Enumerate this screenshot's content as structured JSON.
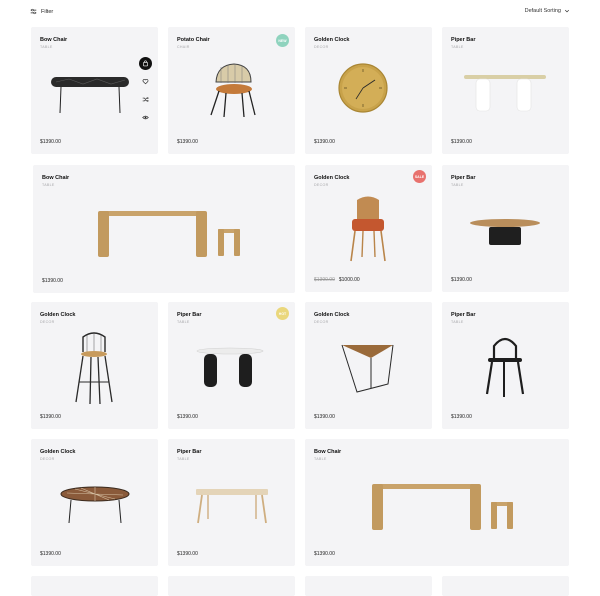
{
  "toolbar": {
    "filter_label": "Filter",
    "sort_label": "Default Sorting"
  },
  "products": [
    {
      "title": "Bow Chair",
      "category": "TABLE",
      "price": "$1390.00"
    },
    {
      "title": "Potato Chair",
      "category": "CHAIR",
      "price": "$1390.00",
      "badge": "NEW",
      "badge_color": "#8fd3be"
    },
    {
      "title": "Golden Clock",
      "category": "DECOR",
      "price": "$1390.00"
    },
    {
      "title": "Piper Bar",
      "category": "TABLE",
      "price": "$1390.00"
    },
    {
      "title": "Bow Chair",
      "category": "TABLE",
      "price": "$1390.00"
    },
    {
      "title": "Golden Clock",
      "category": "DECOR",
      "price": "$1000.00",
      "old_price": "$1390.00",
      "badge": "SALE",
      "badge_color": "#e8726e"
    },
    {
      "title": "Piper Bar",
      "category": "TABLE",
      "price": "$1390.00"
    },
    {
      "title": "Golden Clock",
      "category": "DECOR",
      "price": "$1390.00"
    },
    {
      "title": "Piper Bar",
      "category": "TABLE",
      "price": "$1390.00",
      "badge": "HOT",
      "badge_color": "#ead77c"
    },
    {
      "title": "Golden Clock",
      "category": "DECOR",
      "price": "$1390.00"
    },
    {
      "title": "Piper Bar",
      "category": "TABLE",
      "price": "$1390.00"
    },
    {
      "title": "Golden Clock",
      "category": "DECOR",
      "price": "$1390.00"
    },
    {
      "title": "Piper Bar",
      "category": "TABLE",
      "price": "$1390.00"
    },
    {
      "title": "Bow Chair",
      "category": "TABLE",
      "price": "$1390.00"
    }
  ],
  "quick_actions": [
    "bag-icon",
    "heart-icon",
    "shuffle-icon",
    "eye-icon"
  ]
}
